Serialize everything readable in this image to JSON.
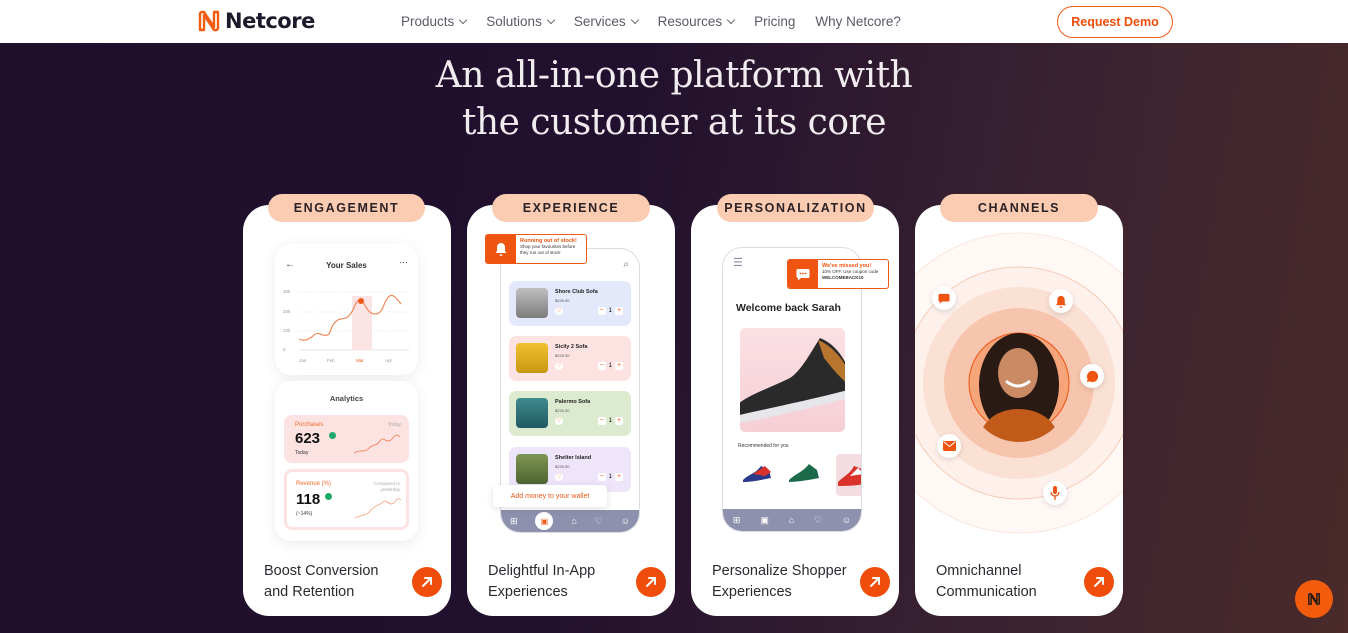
{
  "nav": {
    "brand": "Netcore",
    "menu": [
      {
        "label": "Products",
        "has_dropdown": true
      },
      {
        "label": "Solutions",
        "has_dropdown": true
      },
      {
        "label": "Services",
        "has_dropdown": true
      },
      {
        "label": "Resources",
        "has_dropdown": true
      },
      {
        "label": "Pricing",
        "has_dropdown": false
      },
      {
        "label": "Why Netcore?",
        "has_dropdown": false
      }
    ],
    "cta": "Request Demo"
  },
  "hero": {
    "line1": "An all-in-one platform with",
    "line2": "the customer at its core"
  },
  "colors": {
    "accent": "#f04c0c",
    "tag_bg": "#fbcbb2",
    "bg_dark": "#22112e"
  },
  "cards": [
    {
      "tag": "ENGAGEMENT",
      "title": "Boost Conversion and Retention",
      "title_l1": "Boost Conversion",
      "title_l2": "and Retention",
      "sales": {
        "title": "Your Sales",
        "y_ticks": [
          "30k",
          "20k",
          "10k",
          "0"
        ],
        "x_ticks": [
          "Jan",
          "Feb",
          "Mar",
          "Apr"
        ],
        "highlight": "Mar"
      },
      "analytics": {
        "title": "Analytics",
        "purchases_label": "Purchases",
        "purchases_value": "623",
        "purchases_sub": "Today",
        "purchases_note": "Today",
        "revenue_label": "Revenue (%)",
        "revenue_value": "118",
        "revenue_sub": "(~14%)",
        "revenue_note_1": "Compared to",
        "revenue_note_2": "yesterday"
      }
    },
    {
      "tag": "EXPERIENCE",
      "title_l1": "Delightful In-App",
      "title_l2": "Experiences",
      "toast": {
        "title": "Running out of stock!",
        "text1": "Shop your favourites before",
        "text2": "they run out of stock"
      },
      "products": [
        {
          "name": "Shore Club Sofa",
          "price": "$229.00",
          "qty": "1"
        },
        {
          "name": "Sicily 2 Sofa",
          "price": "$229.00",
          "qty": "1"
        },
        {
          "name": "Palermo Sofa",
          "price": "$229.00",
          "qty": "1"
        },
        {
          "name": "Shelter Island",
          "price": "$229.00",
          "qty": "1"
        }
      ],
      "wallet_tooltip": "Add money to your wallet"
    },
    {
      "tag": "PERSONALIZATION",
      "title_l1": "Personalize Shopper",
      "title_l2": "Experiences",
      "toast": {
        "title": "We've missed you!",
        "text1": "10% OFF. Use coupon code",
        "text2": "WELCOMEBACK10"
      },
      "greeting": "Welcome back Sarah",
      "recommended": "Recommended for you"
    },
    {
      "tag": "CHANNELS",
      "title_l1": "Omnichannel",
      "title_l2": "Communication",
      "channel_icons": [
        "sms-icon",
        "bell-icon",
        "whatsapp-icon",
        "email-icon",
        "microphone-icon"
      ]
    }
  ]
}
